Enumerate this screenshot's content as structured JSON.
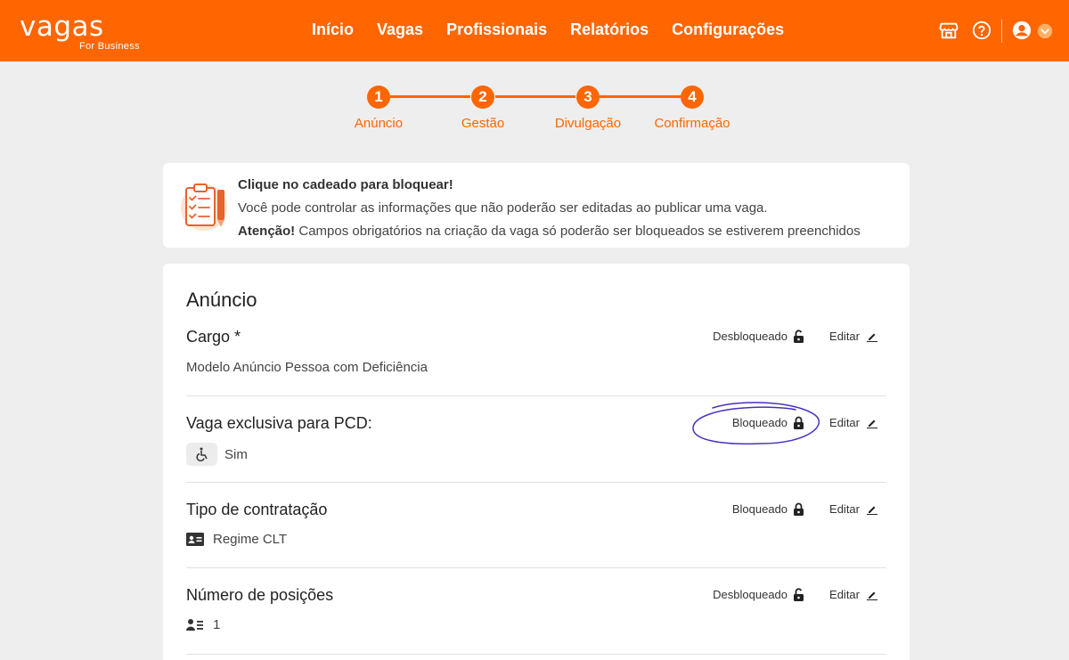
{
  "header": {
    "logo_main": "vagas",
    "logo_sub": "For Business",
    "nav": [
      "Início",
      "Vagas",
      "Profissionais",
      "Relatórios",
      "Configurações"
    ]
  },
  "stepper": {
    "steps": [
      {
        "number": "1",
        "label": "Anúncio"
      },
      {
        "number": "2",
        "label": "Gestão"
      },
      {
        "number": "3",
        "label": "Divulgação"
      },
      {
        "number": "4",
        "label": "Confirmação"
      }
    ]
  },
  "info": {
    "title": "Clique no cadeado para bloquear!",
    "line1": "Você pode controlar as informações que não poderão ser editadas ao publicar uma vaga.",
    "line2_strong": "Atenção!",
    "line2_rest": " Campos obrigatórios na criação da vaga só poderão ser bloqueados se estiverem preenchidos"
  },
  "card": {
    "title": "Anúncio",
    "edit_label": "Editar",
    "fields": [
      {
        "label": "Cargo *",
        "status": "Desbloqueado",
        "value": "Modelo Anúncio Pessoa com Deficiência"
      },
      {
        "label": "Vaga exclusiva para PCD:",
        "status": "Bloqueado",
        "value": "Sim"
      },
      {
        "label": "Tipo de contratação",
        "status": "Bloqueado",
        "value": "Regime CLT"
      },
      {
        "label": "Número de posições",
        "status": "Desbloqueado",
        "value": "1"
      }
    ]
  },
  "colors": {
    "brand": "#ff6600",
    "background": "#eeeeee",
    "annotation": "#4a2fc0"
  }
}
